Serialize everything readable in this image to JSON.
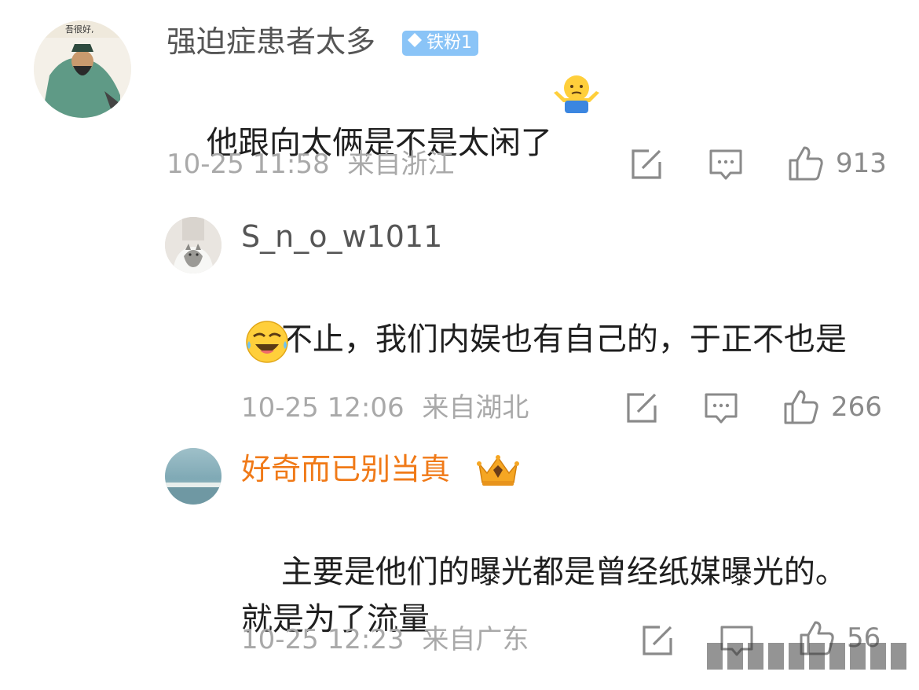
{
  "comments": [
    {
      "username": "强迫症患者太多",
      "badge": "铁粉1",
      "text": "他跟向太俩是不是太闲了",
      "time": "10-25 11:58",
      "location": "来自浙江",
      "likes": "913",
      "avatar_text": "吾很好,"
    },
    {
      "username": "S_n_o_w1011",
      "text": "不止，我们内娱也有自己的，于正不也是",
      "time": "10-25 12:06",
      "location": "来自湖北",
      "likes": "266"
    },
    {
      "username": "好奇而已别当真",
      "text": "主要是他们的曝光都是曾经纸媒曝光的。\n就是为了流量",
      "time": "10-25 12:23",
      "location": "来自广东",
      "likes": "56"
    }
  ],
  "colors": {
    "meta_gray": "#a9a9a9",
    "vip_orange": "#f07a18",
    "badge_blue": "#8ac4f7",
    "icon_gray": "#8a8a8a"
  }
}
